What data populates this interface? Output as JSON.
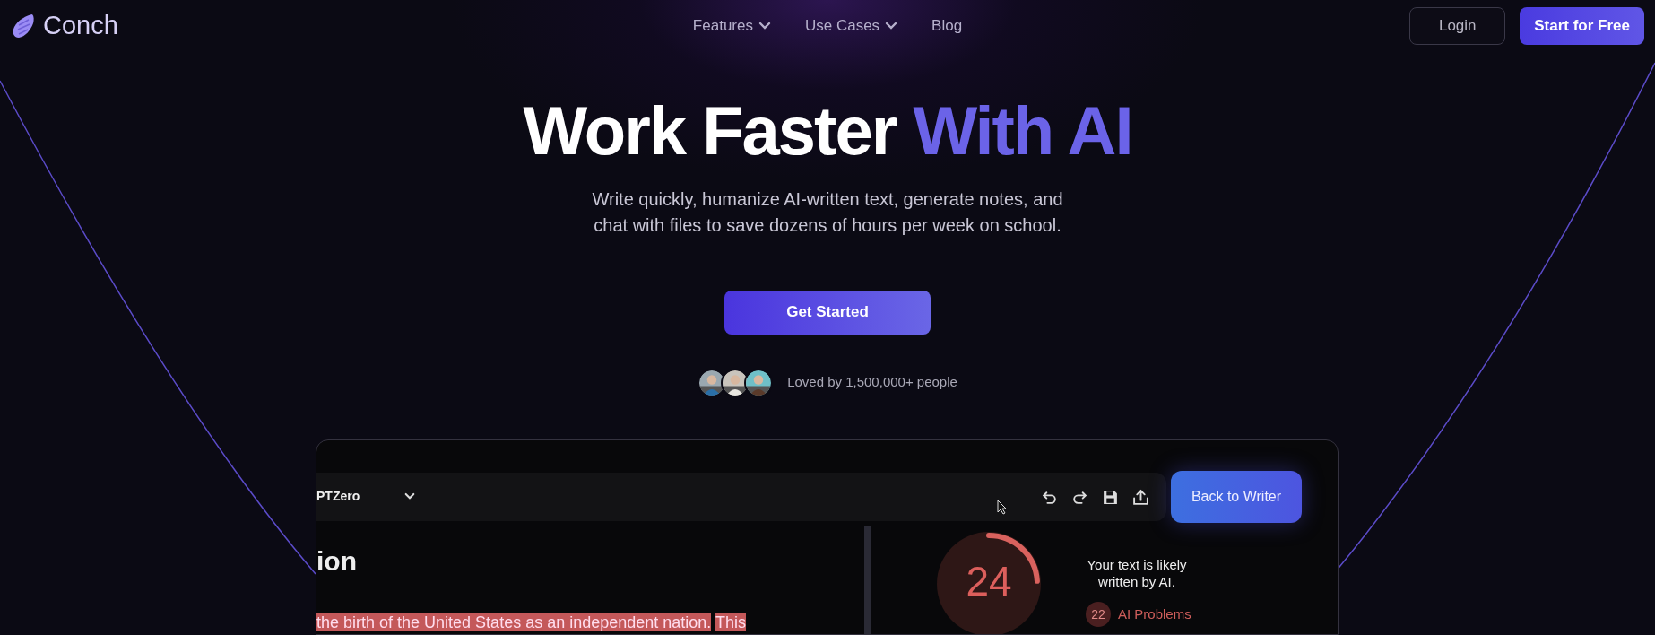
{
  "nav": {
    "logo": "Conch",
    "links": [
      {
        "label": "Features",
        "dropdown": true
      },
      {
        "label": "Use Cases",
        "dropdown": true
      },
      {
        "label": "Blog",
        "dropdown": false
      }
    ],
    "buttons": [
      {
        "label": "Login",
        "kind": "outline"
      },
      {
        "label": "Start for Free",
        "kind": "primary"
      }
    ]
  },
  "hero": {
    "title": "Work Faster",
    "title_accent": "With AI",
    "subtitle": "Write quickly, humanize AI-written text, generate notes, and chat with files to save dozens of hours per week on school.",
    "cta": "Get Started",
    "social_proof": "Loved by 1,500,000+ people"
  },
  "preview": {
    "detector": "PTZero",
    "back_button": "Back to Writer",
    "heading": "ion",
    "highlighted_text": [
      "the birth of the United States as an independent nation.",
      "This"
    ],
    "score": {
      "value": "24",
      "level": 0.24
    },
    "verdict": "Your text is likely written by AI.",
    "problems": {
      "count": "22",
      "label": "AI Problems"
    }
  }
}
